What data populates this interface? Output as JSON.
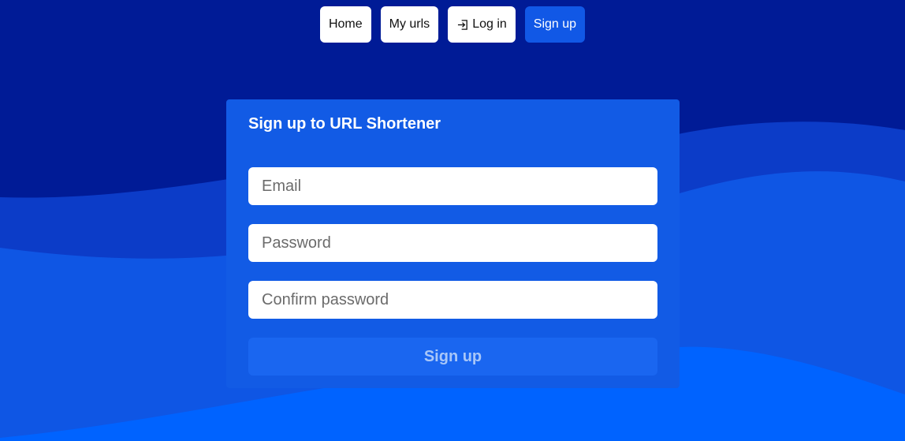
{
  "nav": {
    "items": [
      {
        "label": "Home",
        "icon": null,
        "active": false
      },
      {
        "label": "My urls",
        "icon": null,
        "active": false
      },
      {
        "label": "Log in",
        "icon": "login-icon",
        "active": false
      },
      {
        "label": "Sign up",
        "icon": null,
        "active": true
      }
    ]
  },
  "form": {
    "title": "Sign up to URL Shortener",
    "email_placeholder": "Email",
    "password_placeholder": "Password",
    "confirm_placeholder": "Confirm password",
    "submit_label": "Sign up"
  },
  "colors": {
    "background_dark": "#001b96",
    "wave_mid": "#0c3cc8",
    "wave_light": "#0f56e4",
    "wave_bright": "#0063ff",
    "card": "#125be5",
    "active_nav": "#1158e6",
    "submit_bg": "#1a66f0",
    "submit_text": "#a8c6f8"
  }
}
